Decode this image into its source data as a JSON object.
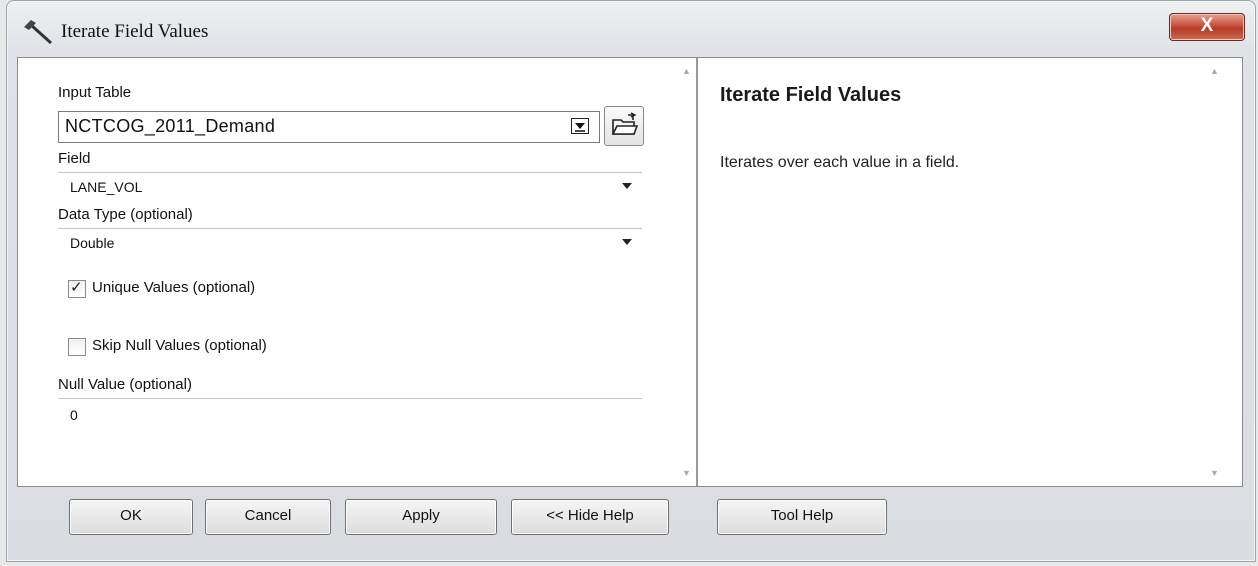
{
  "window": {
    "title": "Iterate Field Values",
    "close_label": "X"
  },
  "form": {
    "input_table": {
      "label": "Input Table",
      "value": "NCTCOG_2011_Demand"
    },
    "field": {
      "label": "Field",
      "value": "LANE_VOL"
    },
    "data_type": {
      "label": "Data Type (optional)",
      "value": "Double"
    },
    "unique_values": {
      "label": "Unique Values (optional)",
      "checked": true
    },
    "skip_null": {
      "label": "Skip Null Values (optional)",
      "checked": false
    },
    "null_value": {
      "label": "Null Value (optional)",
      "value": "0"
    }
  },
  "help": {
    "title": "Iterate Field Values",
    "description": "Iterates over each value in a field."
  },
  "buttons": {
    "ok": "OK",
    "cancel": "Cancel",
    "apply": "Apply",
    "hide_help": "<< Hide Help",
    "tool_help": "Tool Help"
  },
  "icons": {
    "title": "hammer-icon",
    "browse": "folder-open-icon",
    "combo_arrow": "chevron-down-icon"
  }
}
